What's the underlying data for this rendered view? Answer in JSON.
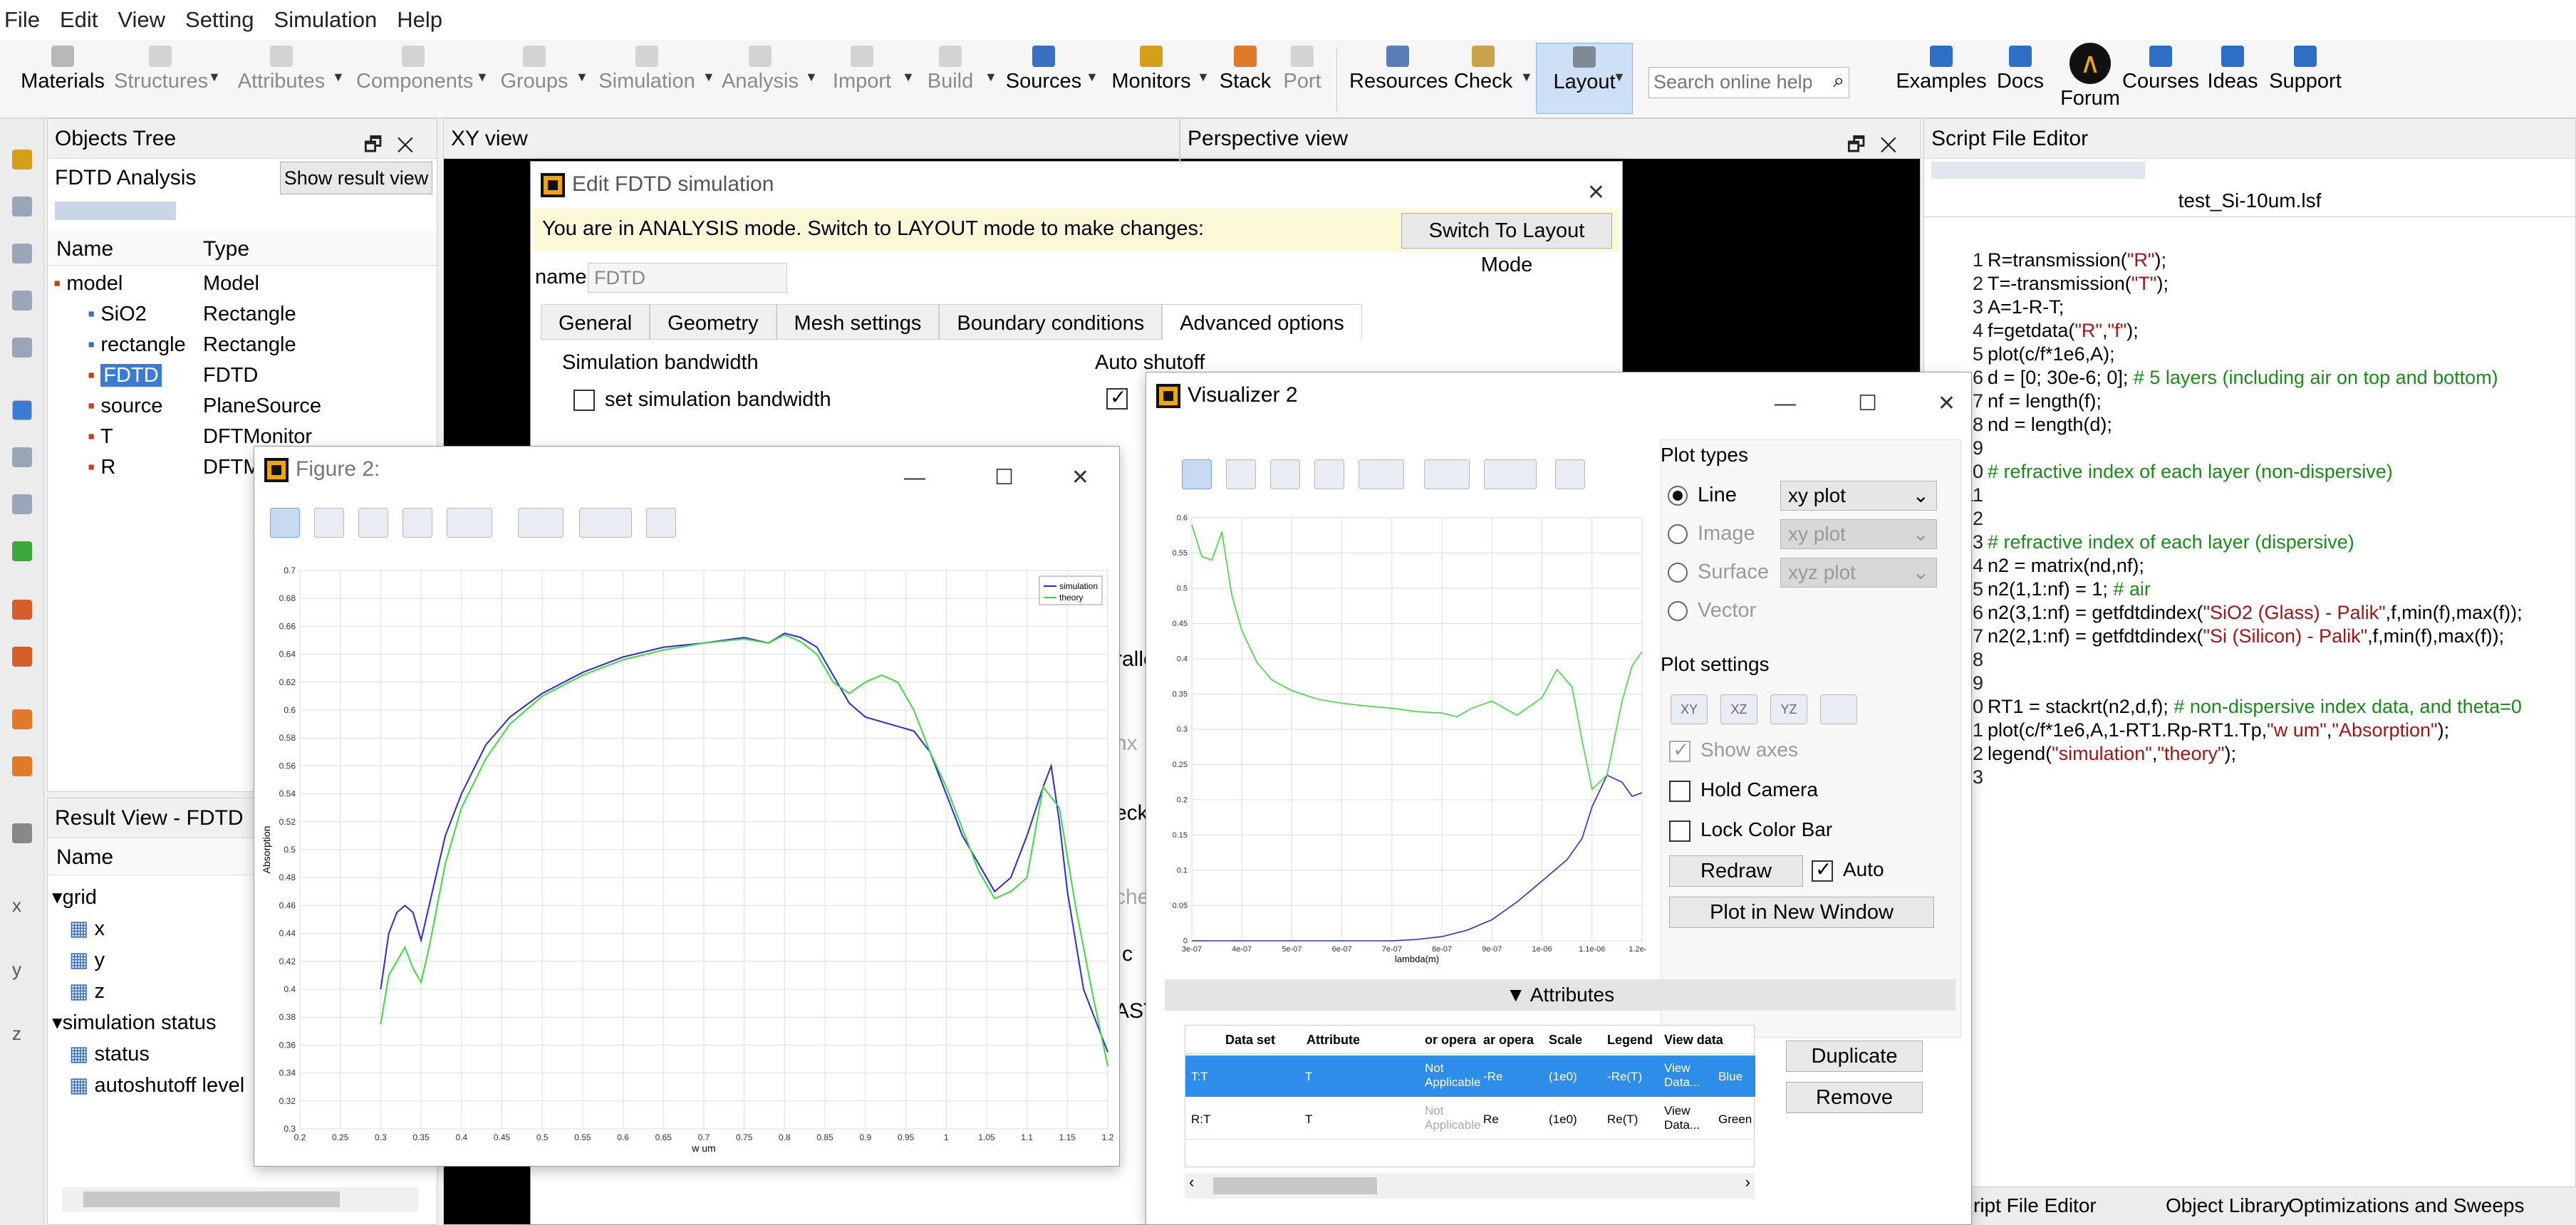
{
  "menu": [
    "File",
    "Edit",
    "View",
    "Setting",
    "Simulation",
    "Help"
  ],
  "ribbon": {
    "materials": "Materials",
    "structures": "Structures",
    "attributes": "Attributes",
    "components": "Components",
    "groups": "Groups",
    "simulation": "Simulation",
    "analysis": "Analysis",
    "import": "Import",
    "build": "Build",
    "sources": "Sources",
    "monitors": "Monitors",
    "stack": "Stack",
    "port": "Port",
    "resources": "Resources",
    "check": "Check",
    "layout": "Layout",
    "search_placeholder": "Search online help",
    "examples": "Examples",
    "docs": "Docs",
    "forum": "Forum",
    "courses": "Courses",
    "ideas": "Ideas",
    "support": "Support"
  },
  "objects_tree": {
    "title": "Objects Tree",
    "mode": "FDTD Analysis",
    "show_result": "Show result view",
    "col_name": "Name",
    "col_type": "Type",
    "rows": [
      {
        "name": "model",
        "type": "Model"
      },
      {
        "name": "SiO2",
        "type": "Rectangle"
      },
      {
        "name": "rectangle",
        "type": "Rectangle"
      },
      {
        "name": "FDTD",
        "type": "FDTD"
      },
      {
        "name": "source",
        "type": "PlaneSource"
      },
      {
        "name": "T",
        "type": "DFTMonitor"
      },
      {
        "name": "R",
        "type": "DFTM"
      }
    ]
  },
  "result_view": {
    "title": "Result View - FDTD",
    "col_name": "Name",
    "items": [
      "grid",
      "x",
      "y",
      "z",
      "simulation status",
      "status",
      "autoshutoff level"
    ]
  },
  "xy_view": "XY view",
  "perspective_view": "Perspective view",
  "edit_fdtd": {
    "title": "Edit FDTD simulation",
    "banner": "You are in ANALYSIS mode.  Switch to LAYOUT mode to make changes:",
    "switch_btn": "Switch To Layout Mode",
    "name_label": "name",
    "name_value": "FDTD",
    "tabs": [
      "General",
      "Geometry",
      "Mesh settings",
      "Boundary conditions",
      "Advanced options"
    ],
    "bandwidth": "Simulation bandwidth",
    "set_bw": "set simulation bandwidth",
    "autoshutoff": "Auto shutoff",
    "frag1": "ralle",
    "frag2": "nx",
    "frag3": "eck",
    "frag4": "che",
    "frag5": "c",
    "frag6": "AST"
  },
  "figure2": {
    "title": "Figure 2:"
  },
  "visualizer": {
    "title": "Visualizer 2",
    "plot_types": "Plot types",
    "line": "Line",
    "image": "Image",
    "surface": "Surface",
    "vector": "Vector",
    "xy_plot": "xy plot",
    "xy_plot2": "xy plot",
    "xyz_plot": "xyz plot",
    "plot_settings": "Plot settings",
    "xy": "XY",
    "xz": "XZ",
    "yz": "YZ",
    "show_axes": "Show axes",
    "hold_camera": "Hold Camera",
    "lock_color": "Lock Color Bar",
    "redraw": "Redraw",
    "auto": "Auto",
    "plot_new": "Plot in New Window",
    "attributes": "Attributes",
    "duplicate": "Duplicate",
    "remove": "Remove",
    "headers": [
      "Data set",
      "Attribute",
      "or opera",
      "ar opera",
      "Scale",
      "Legend",
      "View data",
      ""
    ],
    "rows": [
      [
        "T:T",
        "T",
        "Not Applicable",
        "-Re",
        "(1e0)",
        "-Re(T)",
        "View Data...",
        "Blue"
      ],
      [
        "R:T",
        "T",
        "Not Applicable",
        "Re",
        "(1e0)",
        "Re(T)",
        "View Data...",
        "Green"
      ]
    ]
  },
  "script": {
    "title": "Script File Editor",
    "file": "test_Si-10um.lsf",
    "bottom_tabs": [
      "ript File Editor",
      "Object Library",
      "Optimizations and Sweeps"
    ]
  },
  "chart_data": [
    {
      "type": "line",
      "xlabel": "w um",
      "ylabel": "Absorption",
      "xlim": [
        0.2,
        1.2
      ],
      "ylim": [
        0.3,
        0.7
      ],
      "xticks": [
        "0.2",
        "0.25",
        "0.3",
        "0.35",
        "0.4",
        "0.45",
        "0.5",
        "0.55",
        "0.6",
        "0.65",
        "0.7",
        "0.75",
        "0.8",
        "0.85",
        "0.9",
        "0.95",
        "1",
        "1.05",
        "1.1",
        "1.15",
        "1.2"
      ],
      "yticks": [
        "0.3",
        "0.32",
        "0.34",
        "0.36",
        "0.38",
        "0.4",
        "0.42",
        "0.44",
        "0.46",
        "0.48",
        "0.5",
        "0.52",
        "0.54",
        "0.56",
        "0.58",
        "0.6",
        "0.62",
        "0.64",
        "0.66",
        "0.68",
        "0.7"
      ],
      "legend": [
        "simulation",
        "theory"
      ],
      "series": [
        {
          "name": "simulation",
          "color": "#2b2bd9",
          "x": [
            0.3,
            0.31,
            0.32,
            0.33,
            0.34,
            0.35,
            0.36,
            0.38,
            0.4,
            0.43,
            0.46,
            0.5,
            0.55,
            0.6,
            0.65,
            0.7,
            0.75,
            0.78,
            0.8,
            0.82,
            0.84,
            0.86,
            0.88,
            0.9,
            0.93,
            0.96,
            0.98,
            1.0,
            1.02,
            1.04,
            1.06,
            1.08,
            1.1,
            1.12,
            1.13,
            1.14,
            1.15,
            1.17,
            1.2
          ],
          "y": [
            0.4,
            0.44,
            0.455,
            0.46,
            0.455,
            0.435,
            0.46,
            0.51,
            0.54,
            0.575,
            0.595,
            0.612,
            0.627,
            0.638,
            0.645,
            0.648,
            0.652,
            0.648,
            0.655,
            0.652,
            0.645,
            0.625,
            0.605,
            0.595,
            0.59,
            0.585,
            0.57,
            0.54,
            0.51,
            0.49,
            0.47,
            0.48,
            0.51,
            0.545,
            0.56,
            0.52,
            0.47,
            0.4,
            0.355
          ]
        },
        {
          "name": "theory",
          "color": "#3fd93f",
          "x": [
            0.3,
            0.31,
            0.32,
            0.33,
            0.34,
            0.35,
            0.36,
            0.38,
            0.4,
            0.43,
            0.46,
            0.5,
            0.55,
            0.6,
            0.65,
            0.7,
            0.75,
            0.78,
            0.8,
            0.82,
            0.84,
            0.86,
            0.88,
            0.9,
            0.92,
            0.94,
            0.96,
            0.98,
            1.0,
            1.02,
            1.04,
            1.06,
            1.08,
            1.1,
            1.12,
            1.14,
            1.16,
            1.18,
            1.2
          ],
          "y": [
            0.375,
            0.41,
            0.42,
            0.43,
            0.415,
            0.405,
            0.43,
            0.49,
            0.53,
            0.565,
            0.59,
            0.61,
            0.625,
            0.636,
            0.643,
            0.648,
            0.651,
            0.648,
            0.654,
            0.649,
            0.64,
            0.62,
            0.612,
            0.62,
            0.625,
            0.62,
            0.6,
            0.57,
            0.545,
            0.515,
            0.485,
            0.465,
            0.47,
            0.48,
            0.545,
            0.53,
            0.46,
            0.4,
            0.345
          ]
        }
      ]
    },
    {
      "type": "line",
      "xlabel": "lambda(m)",
      "xlim": [
        3e-07,
        1.2e-06
      ],
      "ylim": [
        0,
        0.6
      ],
      "xticks": [
        "3e-07",
        "4e-07",
        "5e-07",
        "6e-07",
        "7e-07",
        "8e-07",
        "9e-07",
        "1e-06",
        "1.1e-06",
        "1.2e-06"
      ],
      "yticks": [
        "0",
        "0.05",
        "0.1",
        "0.15",
        "0.2",
        "0.25",
        "0.3",
        "0.35",
        "0.4",
        "0.45",
        "0.5",
        "0.55",
        "0.6"
      ],
      "series": [
        {
          "name": "T",
          "color": "#2b2bd9",
          "x": [
            3e-07,
            6e-07,
            7e-07,
            7.5e-07,
            8e-07,
            8.5e-07,
            9e-07,
            9.5e-07,
            1e-06,
            1.05e-06,
            1.08e-06,
            1.1e-06,
            1.13e-06,
            1.16e-06,
            1.18e-06,
            1.2e-06
          ],
          "y": [
            0,
            0,
            0,
            0.002,
            0.006,
            0.015,
            0.03,
            0.055,
            0.085,
            0.115,
            0.145,
            0.19,
            0.235,
            0.225,
            0.205,
            0.21
          ]
        },
        {
          "name": "R",
          "color": "#3fd93f",
          "x": [
            3e-07,
            3.2e-07,
            3.4e-07,
            3.6e-07,
            3.8e-07,
            4e-07,
            4.3e-07,
            4.6e-07,
            5e-07,
            5.5e-07,
            6e-07,
            6.5e-07,
            7e-07,
            7.5e-07,
            8e-07,
            8.3e-07,
            8.6e-07,
            9e-07,
            9.5e-07,
            1e-06,
            1.03e-06,
            1.06e-06,
            1.08e-06,
            1.1e-06,
            1.13e-06,
            1.16e-06,
            1.18e-06,
            1.2e-06
          ],
          "y": [
            0.59,
            0.545,
            0.54,
            0.58,
            0.49,
            0.44,
            0.395,
            0.37,
            0.355,
            0.343,
            0.337,
            0.333,
            0.33,
            0.325,
            0.323,
            0.318,
            0.33,
            0.34,
            0.32,
            0.345,
            0.385,
            0.36,
            0.285,
            0.215,
            0.235,
            0.34,
            0.39,
            0.41
          ]
        }
      ]
    }
  ]
}
